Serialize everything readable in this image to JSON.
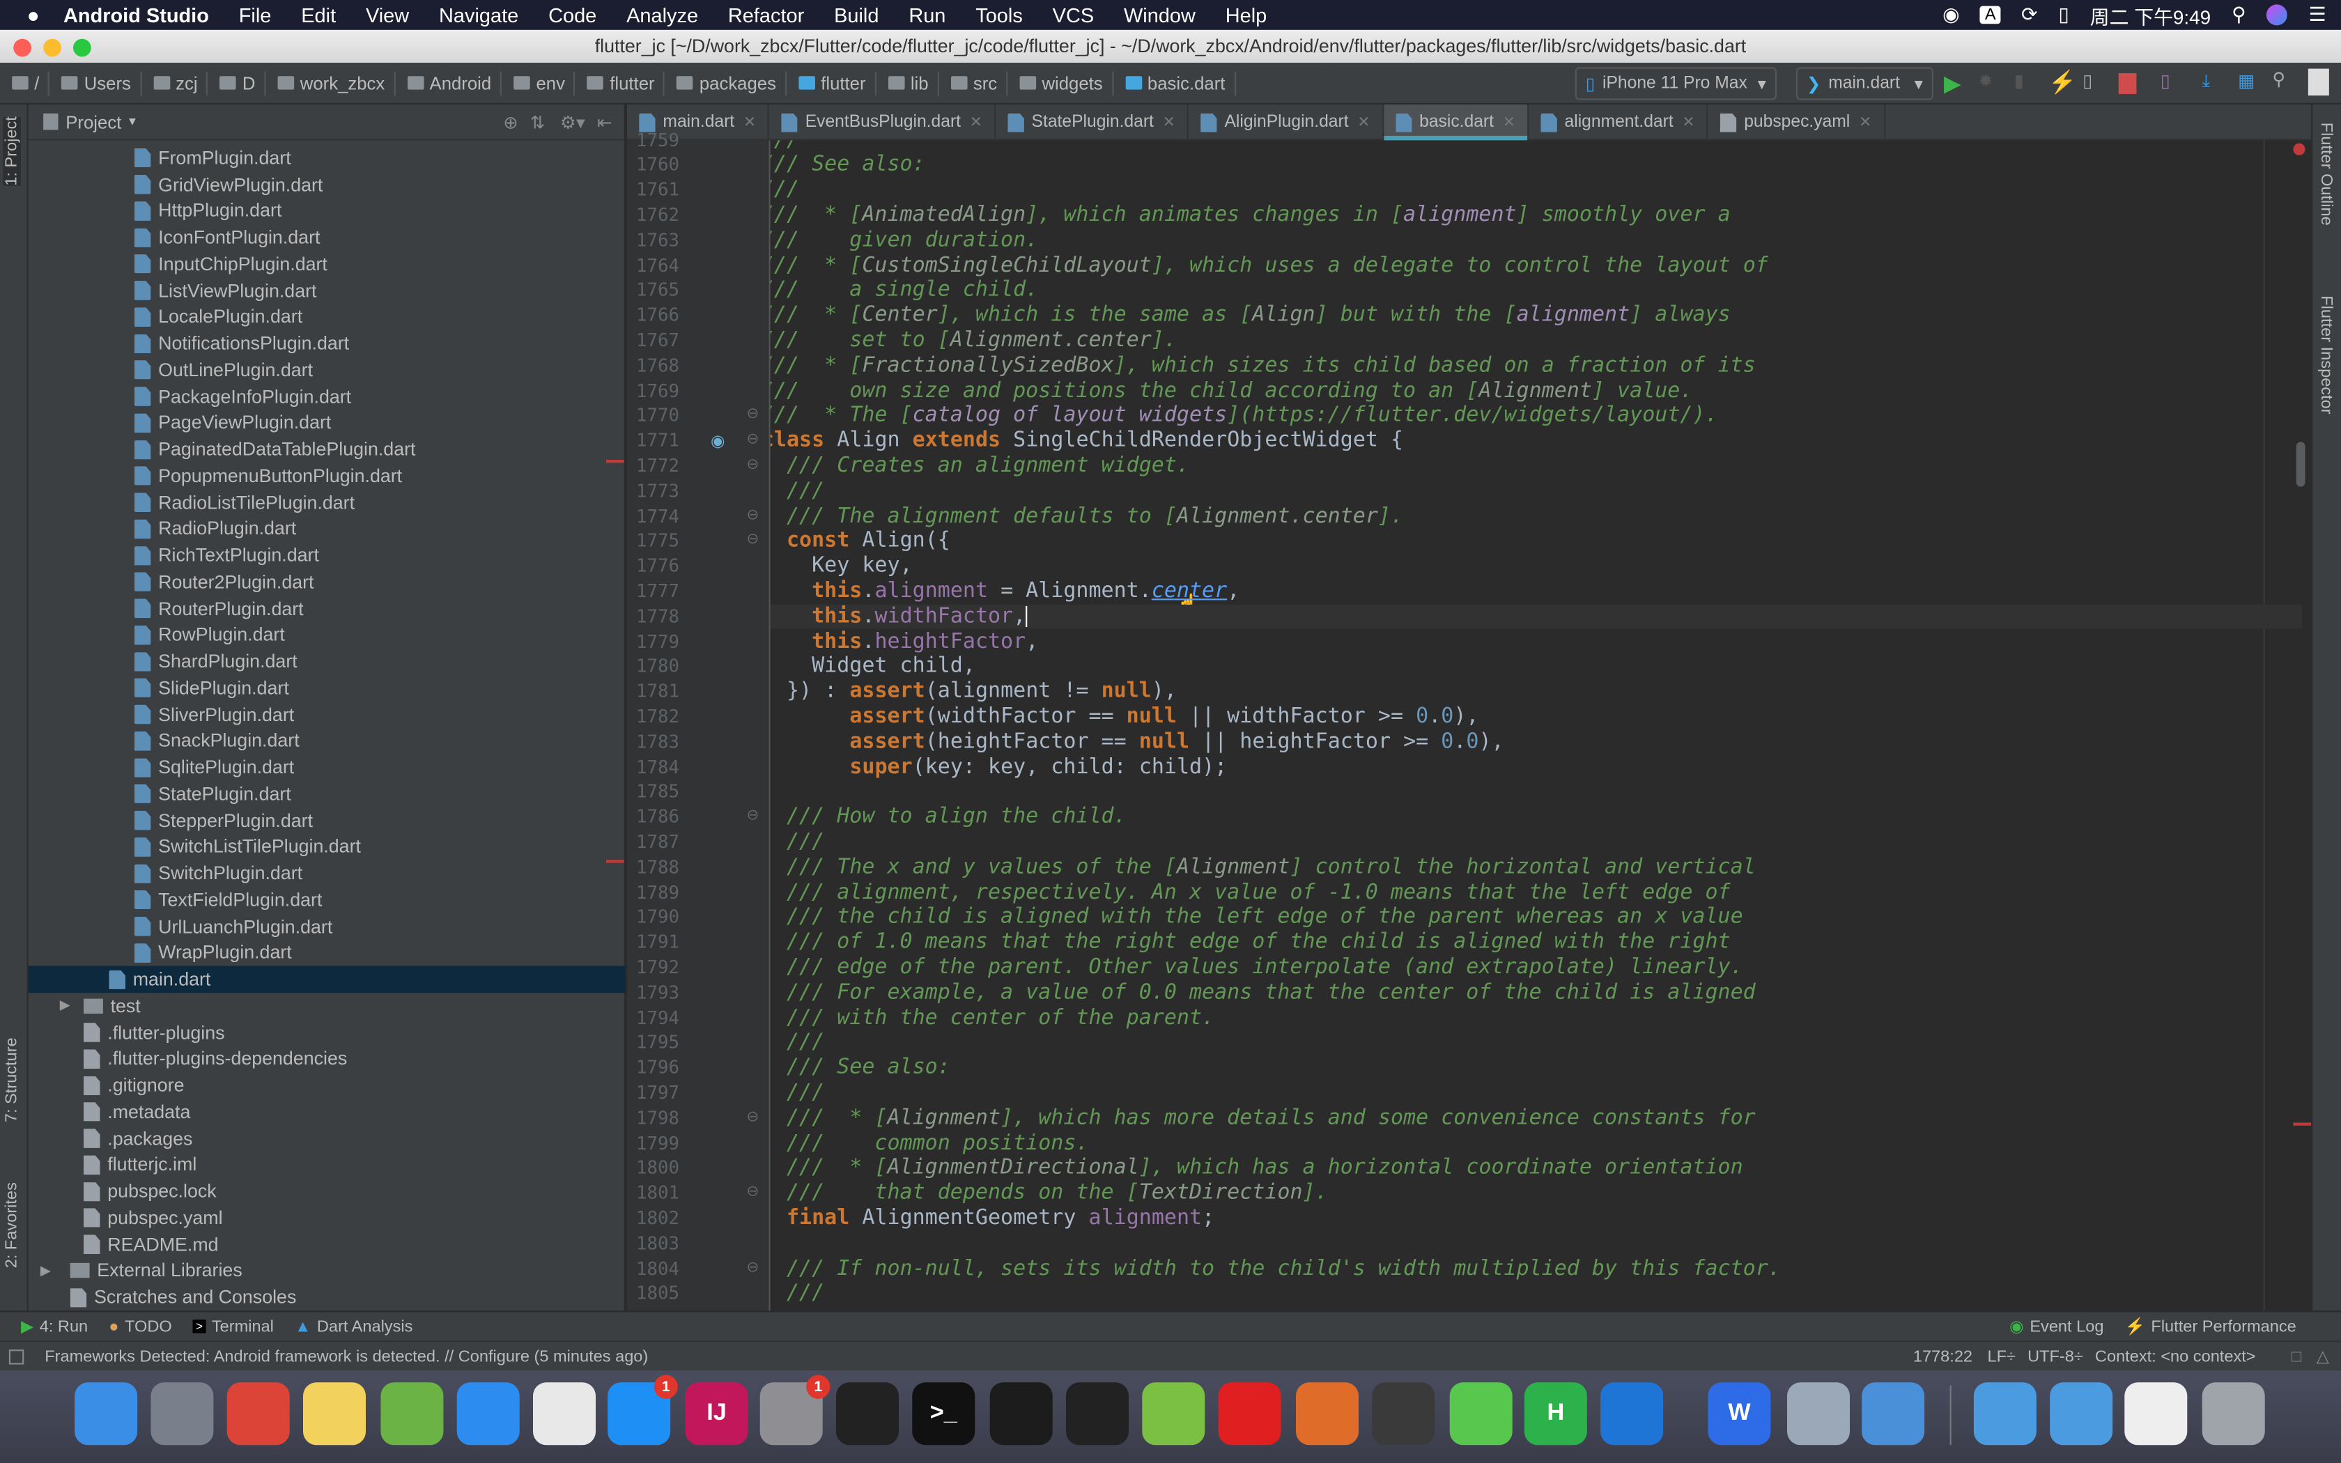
{
  "menubar": {
    "app": "Android Studio",
    "items": [
      "File",
      "Edit",
      "View",
      "Navigate",
      "Code",
      "Analyze",
      "Refactor",
      "Build",
      "Run",
      "Tools",
      "VCS",
      "Window",
      "Help"
    ],
    "clock": "周二 下午9:49",
    "input_method": "A"
  },
  "window": {
    "title": "flutter_jc [~/D/work_zbcx/Flutter/code/flutter_jc/code/flutter_jc] - ~/D/work_zbcx/Android/env/flutter/packages/flutter/lib/src/widgets/basic.dart"
  },
  "breadcrumb": [
    "/",
    "Users",
    "zcj",
    "D",
    "work_zbcx",
    "Android",
    "env",
    "flutter",
    "packages",
    "flutter",
    "lib",
    "src",
    "widgets",
    "basic.dart"
  ],
  "run_toolbar": {
    "device": "iPhone 11 Pro Max",
    "config": "main.dart"
  },
  "project_panel": {
    "title": "Project"
  },
  "tree": [
    {
      "label": "FromPlugin.dart",
      "type": "dart",
      "level": 3
    },
    {
      "label": "GridViewPlugin.dart",
      "type": "dart",
      "level": 3
    },
    {
      "label": "HttpPlugin.dart",
      "type": "dart",
      "level": 3
    },
    {
      "label": "IconFontPlugin.dart",
      "type": "dart",
      "level": 3
    },
    {
      "label": "InputChipPlugin.dart",
      "type": "dart",
      "level": 3
    },
    {
      "label": "ListViewPlugin.dart",
      "type": "dart",
      "level": 3
    },
    {
      "label": "LocalePlugin.dart",
      "type": "dart",
      "level": 3
    },
    {
      "label": "NotificationsPlugin.dart",
      "type": "dart",
      "level": 3
    },
    {
      "label": "OutLinePlugin.dart",
      "type": "dart",
      "level": 3
    },
    {
      "label": "PackageInfoPlugin.dart",
      "type": "dart",
      "level": 3
    },
    {
      "label": "PageViewPlugin.dart",
      "type": "dart",
      "level": 3
    },
    {
      "label": "PaginatedDataTablePlugin.dart",
      "type": "dart",
      "level": 3
    },
    {
      "label": "PopupmenuButtonPlugin.dart",
      "type": "dart",
      "level": 3
    },
    {
      "label": "RadioListTilePlugin.dart",
      "type": "dart",
      "level": 3
    },
    {
      "label": "RadioPlugin.dart",
      "type": "dart",
      "level": 3
    },
    {
      "label": "RichTextPlugin.dart",
      "type": "dart",
      "level": 3
    },
    {
      "label": "Router2Plugin.dart",
      "type": "dart",
      "level": 3
    },
    {
      "label": "RouterPlugin.dart",
      "type": "dart",
      "level": 3
    },
    {
      "label": "RowPlugin.dart",
      "type": "dart",
      "level": 3
    },
    {
      "label": "ShardPlugin.dart",
      "type": "dart",
      "level": 3
    },
    {
      "label": "SlidePlugin.dart",
      "type": "dart",
      "level": 3
    },
    {
      "label": "SliverPlugin.dart",
      "type": "dart",
      "level": 3
    },
    {
      "label": "SnackPlugin.dart",
      "type": "dart",
      "level": 3
    },
    {
      "label": "SqlitePlugin.dart",
      "type": "dart",
      "level": 3
    },
    {
      "label": "StatePlugin.dart",
      "type": "dart",
      "level": 3
    },
    {
      "label": "StepperPlugin.dart",
      "type": "dart",
      "level": 3
    },
    {
      "label": "SwitchListTilePlugin.dart",
      "type": "dart",
      "level": 3
    },
    {
      "label": "SwitchPlugin.dart",
      "type": "dart",
      "level": 3
    },
    {
      "label": "TextFieldPlugin.dart",
      "type": "dart",
      "level": 3
    },
    {
      "label": "UrlLuanchPlugin.dart",
      "type": "dart",
      "level": 3
    },
    {
      "label": "WrapPlugin.dart",
      "type": "dart",
      "level": 3
    },
    {
      "label": "main.dart",
      "type": "dart",
      "level": 2,
      "selected": true
    },
    {
      "label": "test",
      "type": "folder",
      "level": 1,
      "collapsed": true
    },
    {
      "label": ".flutter-plugins",
      "type": "file",
      "level": 1
    },
    {
      "label": ".flutter-plugins-dependencies",
      "type": "file",
      "level": 1
    },
    {
      "label": ".gitignore",
      "type": "file",
      "level": 1
    },
    {
      "label": ".metadata",
      "type": "file",
      "level": 1
    },
    {
      "label": ".packages",
      "type": "file",
      "level": 1
    },
    {
      "label": "flutterjc.iml",
      "type": "file",
      "level": 1
    },
    {
      "label": "pubspec.lock",
      "type": "file",
      "level": 1
    },
    {
      "label": "pubspec.yaml",
      "type": "file",
      "level": 1
    },
    {
      "label": "README.md",
      "type": "file",
      "level": 1
    },
    {
      "label": "External Libraries",
      "type": "lib",
      "level": 0,
      "collapsed": true
    },
    {
      "label": "Scratches and Consoles",
      "type": "file",
      "level": 0
    }
  ],
  "tabs": [
    {
      "label": "main.dart"
    },
    {
      "label": "EventBusPlugin.dart"
    },
    {
      "label": "StatePlugin.dart"
    },
    {
      "label": "AliginPlugin.dart"
    },
    {
      "label": "basic.dart",
      "active": true
    },
    {
      "label": "alignment.dart"
    },
    {
      "label": "pubspec.yaml"
    }
  ],
  "editor": {
    "first_line": 1759,
    "current_line": 1778,
    "lines": [
      "///",
      "/// See also:",
      "///",
      "///  * [AnimatedAlign], which animates changes in [alignment] smoothly over a",
      "///    given duration.",
      "///  * [CustomSingleChildLayout], which uses a delegate to control the layout of",
      "///    a single child.",
      "///  * [Center], which is the same as [Align] but with the [alignment] always",
      "///    set to [Alignment.center].",
      "///  * [FractionallySizedBox], which sizes its child based on a fraction of its",
      "///    own size and positions the child according to an [Alignment] value.",
      "///  * The [catalog of layout widgets](https://flutter.dev/widgets/layout/).",
      "class Align extends SingleChildRenderObjectWidget {",
      "  /// Creates an alignment widget.",
      "  ///",
      "  /// The alignment defaults to [Alignment.center].",
      "  const Align({",
      "    Key key,",
      "    this.alignment = Alignment.center,",
      "    this.widthFactor,",
      "    this.heightFactor,",
      "    Widget child,",
      "  }) : assert(alignment != null),",
      "       assert(widthFactor == null || widthFactor >= 0.0),",
      "       assert(heightFactor == null || heightFactor >= 0.0),",
      "       super(key: key, child: child);",
      "",
      "  /// How to align the child.",
      "  ///",
      "  /// The x and y values of the [Alignment] control the horizontal and vertical",
      "  /// alignment, respectively. An x value of -1.0 means that the left edge of",
      "  /// the child is aligned with the left edge of the parent whereas an x value",
      "  /// of 1.0 means that the right edge of the child is aligned with the right",
      "  /// edge of the parent. Other values interpolate (and extrapolate) linearly.",
      "  /// For example, a value of 0.0 means that the center of the child is aligned",
      "  /// with the center of the parent.",
      "  ///",
      "  /// See also:",
      "  ///",
      "  ///  * [Alignment], which has more details and some convenience constants for",
      "  ///    common positions.",
      "  ///  * [AlignmentDirectional], which has a horizontal coordinate orientation",
      "  ///    that depends on the [TextDirection].",
      "  final AlignmentGeometry alignment;",
      "",
      "  /// If non-null, sets its width to the child's width multiplied by this factor.",
      "  ///"
    ]
  },
  "right_strip": [
    "Flutter Outline",
    "Flutter Inspector"
  ],
  "left_strip": [
    "1: Project",
    "7: Structure",
    "2: Favorites"
  ],
  "tool_windows": {
    "left": [
      "4: Run",
      "TODO",
      "Terminal",
      "Dart Analysis"
    ],
    "right": [
      "Event Log",
      "Flutter Performance"
    ]
  },
  "status": {
    "message": "Frameworks Detected: Android framework is detected. // Configure (5 minutes ago)",
    "position": "1778:22",
    "line_sep": "LF÷",
    "encoding": "UTF-8÷",
    "context": "Context: <no context>"
  },
  "dock": [
    {
      "name": "finder",
      "color": "#3A8EE6"
    },
    {
      "name": "launchpad",
      "color": "#7A7F8C"
    },
    {
      "name": "chrome",
      "color": "#DB4437"
    },
    {
      "name": "notes",
      "color": "#F2D15C"
    },
    {
      "name": "android-studio",
      "color": "#6AB344"
    },
    {
      "name": "safari",
      "color": "#2D8CF0"
    },
    {
      "name": "textedit",
      "color": "#E8E8E8"
    },
    {
      "name": "app-store",
      "color": "#1E90F5",
      "badge": "1"
    },
    {
      "name": "intellij",
      "color": "#C2185B",
      "text": "IJ"
    },
    {
      "name": "system-preferences",
      "color": "#8E8E93",
      "badge": "1"
    },
    {
      "name": "qq",
      "color": "#222222"
    },
    {
      "name": "terminal",
      "color": "#111111",
      "text": ">_"
    },
    {
      "name": "activity-monitor",
      "color": "#1c1c1c"
    },
    {
      "name": "motion-pro",
      "color": "#222222"
    },
    {
      "name": "wechat",
      "color": "#7BC043"
    },
    {
      "name": "netease-music",
      "color": "#E02020"
    },
    {
      "name": "nova",
      "color": "#E06C2A"
    },
    {
      "name": "quicktime",
      "color": "#3a3a3a"
    },
    {
      "name": "messages",
      "color": "#57C84D"
    },
    {
      "name": "hbuilder",
      "color": "#2DB14A",
      "text": "H"
    },
    {
      "name": "xcode",
      "color": "#1F75D6"
    },
    {
      "name": "wps",
      "color": "#2E6BE6",
      "text": "W"
    },
    {
      "name": "preview",
      "color": "#9AA8B8"
    },
    {
      "name": "instruments",
      "color": "#4A90D9"
    },
    {
      "name": "folder-1",
      "color": "#4A9BE0"
    },
    {
      "name": "folder-2",
      "color": "#4A9BE0"
    },
    {
      "name": "xlsx-file",
      "color": "#EEEEEE"
    },
    {
      "name": "trash",
      "color": "#9FA4AA"
    }
  ]
}
